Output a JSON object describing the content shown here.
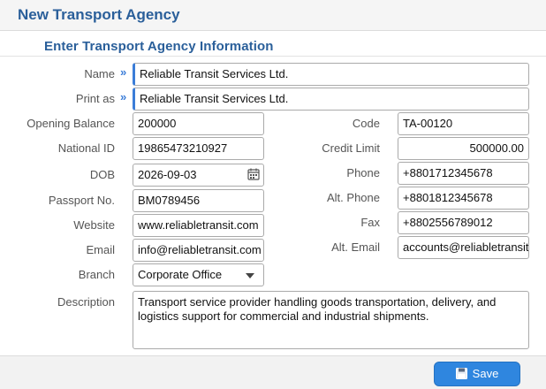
{
  "window": {
    "title": "New Transport Agency"
  },
  "section": {
    "title": "Enter Transport Agency Information"
  },
  "fields": {
    "name": {
      "label": "Name",
      "value": "Reliable Transit Services Ltd."
    },
    "print_as": {
      "label": "Print as",
      "value": "Reliable Transit Services Ltd."
    },
    "opening_balance": {
      "label": "Opening Balance",
      "value": "200000"
    },
    "code": {
      "label": "Code",
      "value": "TA-00120"
    },
    "national_id": {
      "label": "National ID",
      "value": "19865473210927"
    },
    "credit_limit": {
      "label": "Credit Limit",
      "value": "500000.00"
    },
    "dob": {
      "label": "DOB",
      "value": "2026-09-03"
    },
    "phone": {
      "label": "Phone",
      "value": "+8801712345678"
    },
    "passport": {
      "label": "Passport No.",
      "value": "BM0789456"
    },
    "alt_phone": {
      "label": "Alt. Phone",
      "value": "+8801812345678"
    },
    "website": {
      "label": "Website",
      "value": "www.reliabletransit.com"
    },
    "fax": {
      "label": "Fax",
      "value": "+8802556789012"
    },
    "email": {
      "label": "Email",
      "value": "info@reliabletransit.com"
    },
    "alt_email": {
      "label": "Alt. Email",
      "value": "accounts@reliabletransit.com"
    },
    "branch": {
      "label": "Branch",
      "value": "Corporate Office"
    },
    "description": {
      "label": "Description",
      "value": "Transport service provider handling goods transportation, delivery, and logistics support for commercial and industrial shipments."
    }
  },
  "icons": {
    "lookup": "double-chevron-right-icon",
    "calendar": "calendar-icon",
    "save": "floppy-disk-icon"
  },
  "footer": {
    "save_label": "Save"
  },
  "colors": {
    "accent": "#2a5f9a",
    "button": "#2f86df",
    "arrow": "#3b7dd8"
  }
}
